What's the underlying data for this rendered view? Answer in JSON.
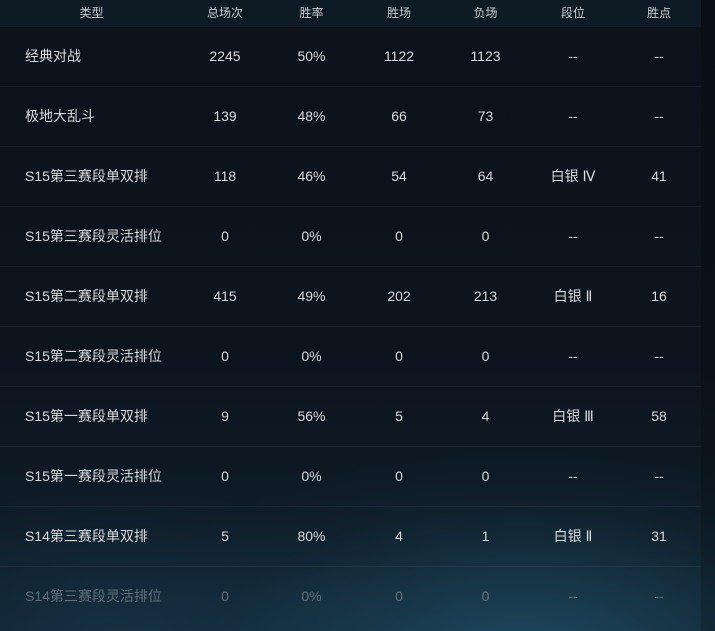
{
  "table": {
    "headers": {
      "type": "类型",
      "total": "总场次",
      "rate": "胜率",
      "wins": "胜场",
      "losses": "负场",
      "rank": "段位",
      "lp": "胜点"
    },
    "rows": [
      {
        "type": "经典对战",
        "total": "2245",
        "rate": "50%",
        "wins": "1122",
        "losses": "1123",
        "rank": "--",
        "lp": "--"
      },
      {
        "type": "极地大乱斗",
        "total": "139",
        "rate": "48%",
        "wins": "66",
        "losses": "73",
        "rank": "--",
        "lp": "--"
      },
      {
        "type": "S15第三赛段单双排",
        "total": "118",
        "rate": "46%",
        "wins": "54",
        "losses": "64",
        "rank": "白银 Ⅳ",
        "lp": "41"
      },
      {
        "type": "S15第三赛段灵活排位",
        "total": "0",
        "rate": "0%",
        "wins": "0",
        "losses": "0",
        "rank": "--",
        "lp": "--"
      },
      {
        "type": "S15第二赛段单双排",
        "total": "415",
        "rate": "49%",
        "wins": "202",
        "losses": "213",
        "rank": "白银 Ⅱ",
        "lp": "16"
      },
      {
        "type": "S15第二赛段灵活排位",
        "total": "0",
        "rate": "0%",
        "wins": "0",
        "losses": "0",
        "rank": "--",
        "lp": "--"
      },
      {
        "type": "S15第一赛段单双排",
        "total": "9",
        "rate": "56%",
        "wins": "5",
        "losses": "4",
        "rank": "白银 Ⅲ",
        "lp": "58"
      },
      {
        "type": "S15第一赛段灵活排位",
        "total": "0",
        "rate": "0%",
        "wins": "0",
        "losses": "0",
        "rank": "--",
        "lp": "--"
      },
      {
        "type": "S14第三赛段单双排",
        "total": "5",
        "rate": "80%",
        "wins": "4",
        "losses": "1",
        "rank": "白银 Ⅱ",
        "lp": "31"
      },
      {
        "type": "S14第三赛段灵活排位",
        "total": "0",
        "rate": "0%",
        "wins": "0",
        "losses": "0",
        "rank": "--",
        "lp": "--"
      }
    ]
  },
  "colors": {
    "background": "#0c121a",
    "header_background": "#0e1b24",
    "text": "#d8dbde",
    "accent_glow": "#286e8c"
  }
}
